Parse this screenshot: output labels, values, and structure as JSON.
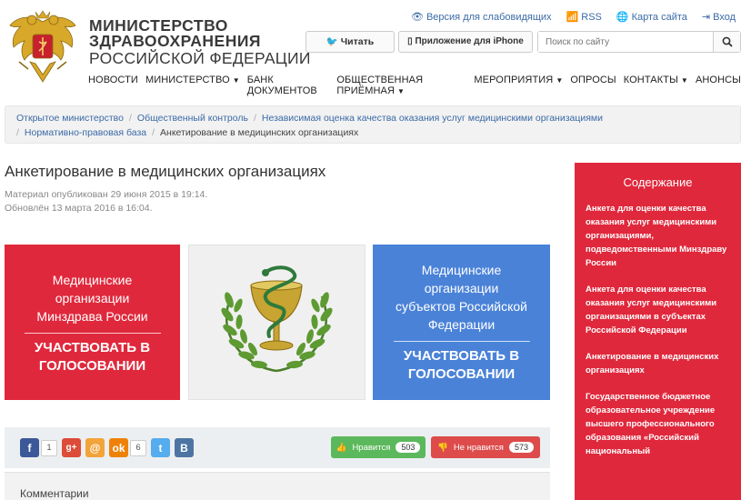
{
  "brand": {
    "line1": "МИНИСТЕРСТВО",
    "line2": "ЗДРАВООХРАНЕНИЯ",
    "line3": "РОССИЙСКОЙ ФЕДЕРАЦИИ"
  },
  "toplinks": {
    "accessibility": "Версия для слабовидящих",
    "rss": "RSS",
    "sitemap": "Карта сайта",
    "login": "Вход"
  },
  "header_buttons": {
    "twitter": "Читать",
    "iphone": "Приложение для iPhone"
  },
  "search": {
    "placeholder": "Поиск по сайту"
  },
  "nav": [
    {
      "label": "НОВОСТИ",
      "dropdown": false
    },
    {
      "label": "МИНИСТЕРСТВО",
      "dropdown": true
    },
    {
      "label": "БАНК ДОКУМЕНТОВ",
      "dropdown": false
    },
    {
      "label": "ОБЩЕСТВЕННАЯ ПРИЁМНАЯ",
      "dropdown": true
    },
    {
      "label": "МЕРОПРИЯТИЯ",
      "dropdown": true
    },
    {
      "label": "ОПРОСЫ",
      "dropdown": false
    },
    {
      "label": "КОНТАКТЫ",
      "dropdown": true
    },
    {
      "label": "АНОНСЫ",
      "dropdown": false
    }
  ],
  "breadcrumb": {
    "item1": "Открытое министерство",
    "item2": "Общественный контроль",
    "item3": "Независимая оценка качества оказания услуг медицинскими организациями",
    "item4": "Нормативно-правовая база",
    "current": "Анкетирование в медицинских организациях"
  },
  "page": {
    "title": "Анкетирование в медицинских организациях",
    "published": "Материал опубликован 29 июня 2015 в 19:14.",
    "updated": "Обновлён 13 марта 2016 в 16:04."
  },
  "tiles": {
    "red": {
      "line1": "Медицинские",
      "line2": "организации",
      "line3": "Минздрава России",
      "cta1": "УЧАСТВОВАТЬ В",
      "cta2": "ГОЛОСОВАНИИ"
    },
    "blue": {
      "line1": "Медицинские",
      "line2": "организации",
      "line3": "субъектов Российской",
      "line4": "Федерации",
      "cta1": "УЧАСТВОВАТЬ В",
      "cta2": "ГОЛОСОВАНИИ"
    }
  },
  "social": {
    "fb_count": "1",
    "ok_count": "6",
    "like_label": "Нравится",
    "like_count": "503",
    "dislike_label": "Не нравится",
    "dislike_count": "573"
  },
  "comments": {
    "label": "Комментарии"
  },
  "toc": {
    "heading": "Содержание",
    "items": [
      "Анкета для оценки качества оказания услуг медицинскими организациями, подведомственными Минздраву России",
      "Анкета для оценки качества оказания услуг медицинскими организациями в субъектах Российской Федерации",
      "Анкетирование в медицинских организациях",
      "Государственное бюджетное образовательное учреждение высшего профессионального образования «Российский национальный"
    ]
  },
  "colors": {
    "red": "#e0283c",
    "blue": "#4a82d8",
    "link": "#3b6aa6",
    "like": "#5cb85c",
    "dislike": "#dd4b4b"
  }
}
